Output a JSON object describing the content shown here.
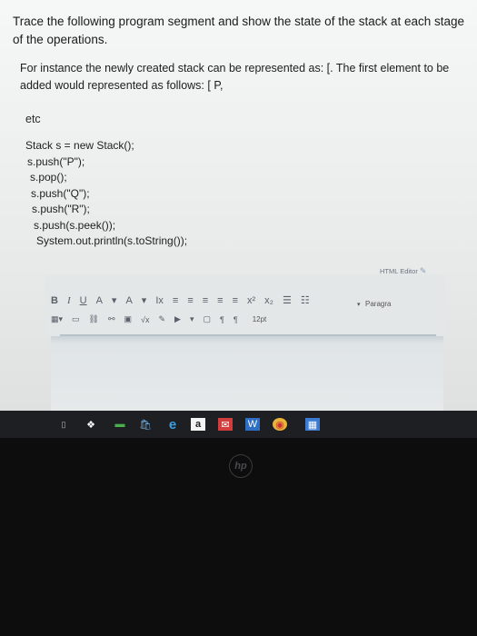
{
  "question": {
    "text": "Trace the following program segment and show the state of the stack at each stage of the operations.",
    "instance": "For instance the newly created stack can be represented as: [. The first element to be added would represented as follows: [ P,",
    "etc": "etc"
  },
  "code_lines": [
    "Stack s = new Stack();",
    "s.push(\"P\");",
    "s.pop();",
    "s.push(\"Q\");",
    "s.push(\"R\");",
    "s.push(s.peek());",
    "System.out.println(s.toString());"
  ],
  "editor": {
    "label": "HTML Editor",
    "font_size": "12pt",
    "paragraph": "Paragra"
  },
  "toolbar_icons": {
    "bold": "B",
    "italic": "I",
    "underline": "U",
    "font_color": "A",
    "bg_color": "A",
    "clear_format": "Ix",
    "superscript": "x²",
    "subscript": "x₂"
  },
  "taskbar": {
    "app_letter": "a"
  }
}
